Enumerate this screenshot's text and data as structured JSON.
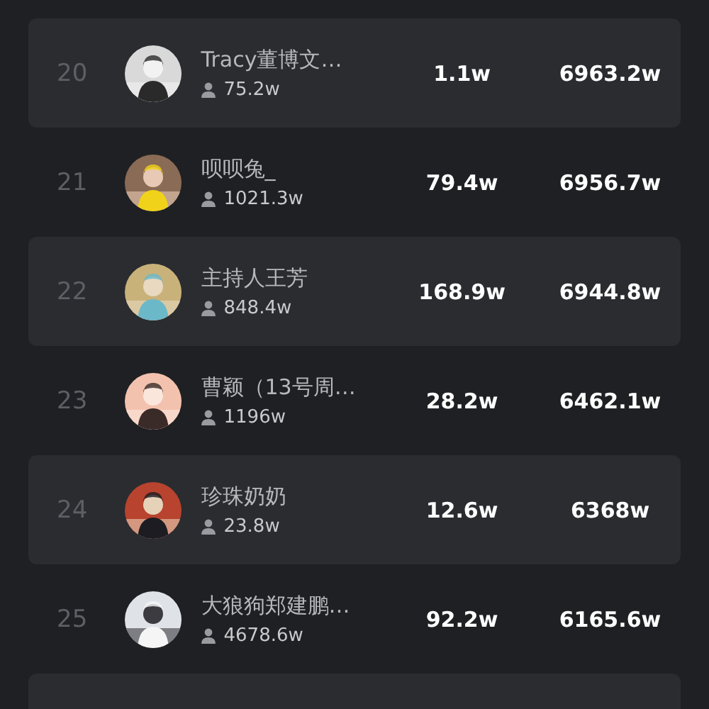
{
  "rows": [
    {
      "rank": "20",
      "name": "Tracy董博文…",
      "followers": "75.2w",
      "column_3": "1.1w",
      "column_4": "6963.2w"
    },
    {
      "rank": "21",
      "name": "呗呗兔_",
      "followers": "1021.3w",
      "column_3": "79.4w",
      "column_4": "6956.7w"
    },
    {
      "rank": "22",
      "name": "主持人王芳",
      "followers": "848.4w",
      "column_3": "168.9w",
      "column_4": "6944.8w"
    },
    {
      "rank": "23",
      "name": "曹颖（13号周…",
      "followers": "1196w",
      "column_3": "28.2w",
      "column_4": "6462.1w"
    },
    {
      "rank": "24",
      "name": "珍珠奶奶",
      "followers": "23.8w",
      "column_3": "12.6w",
      "column_4": "6368w"
    },
    {
      "rank": "25",
      "name": "大狼狗郑建鹏…",
      "followers": "4678.6w",
      "column_3": "92.2w",
      "column_4": "6165.6w"
    }
  ]
}
